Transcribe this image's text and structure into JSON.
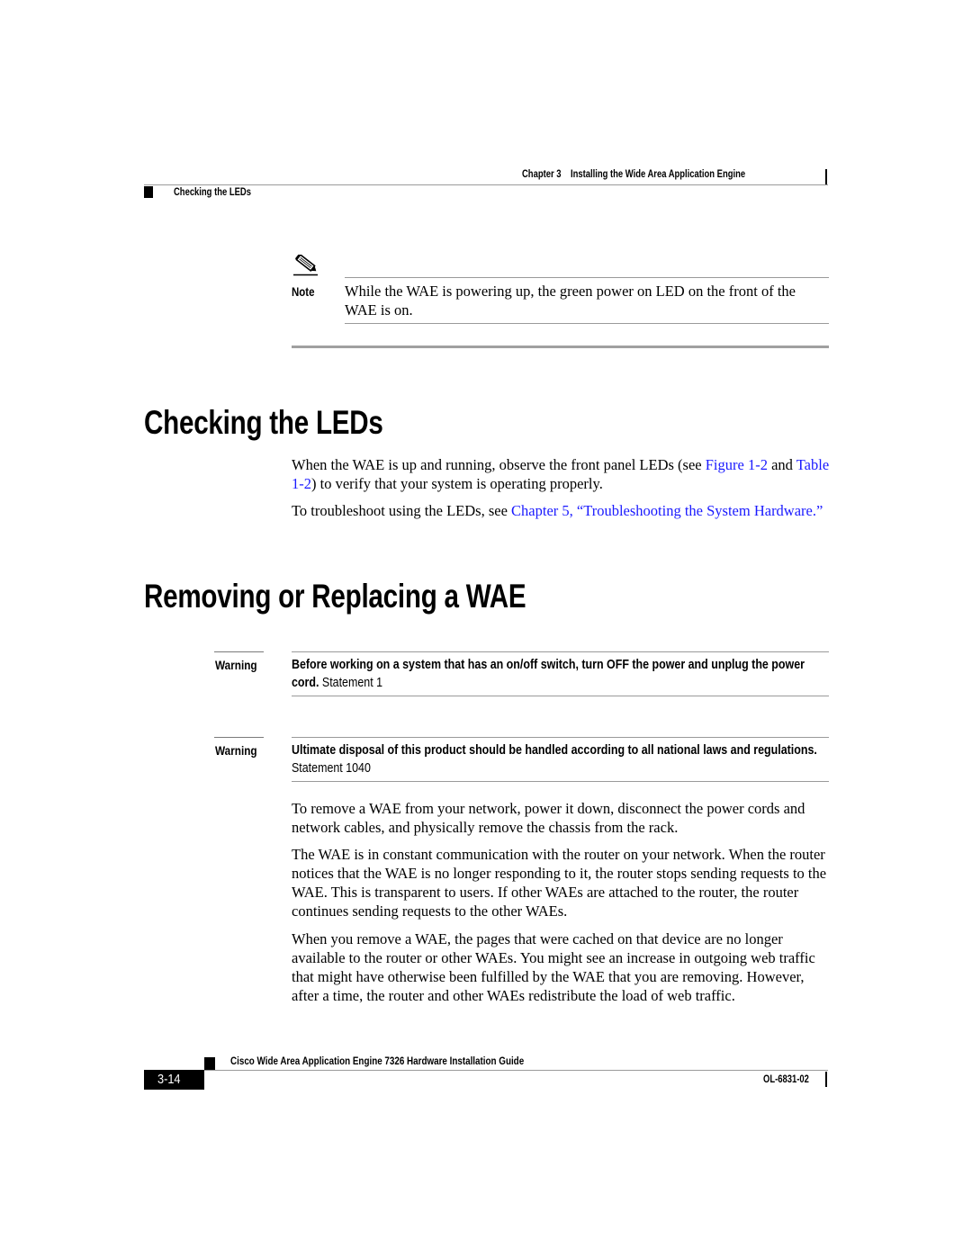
{
  "header": {
    "chapter_label": "Chapter 3",
    "chapter_title": "Installing the Wide Area Application Engine",
    "section": "Checking the LEDs"
  },
  "note": {
    "icon": "pencil-note-icon",
    "label": "Note",
    "text": "While the WAE is powering up, the green power on LED on the front of the WAE is on."
  },
  "sections": [
    {
      "heading": "Checking the LEDs",
      "paragraphs": [
        {
          "t1": "When the WAE is up and running, observe the front panel LEDs (see ",
          "link1": "Figure 1-2",
          "t2": " and ",
          "link2": "Table 1-2",
          "t3": ") to verify that your system is operating properly."
        },
        {
          "t1": "To troubleshoot using the LEDs, see ",
          "link1": "Chapter 5, “Troubleshooting the System Hardware.”"
        }
      ]
    },
    {
      "heading": "Removing or Replacing a WAE",
      "warnings": [
        {
          "label": "Warning",
          "bold": "Before working on a system that has an on/off switch, turn OFF the power and unplug the power cord.",
          "statement": " Statement 1"
        },
        {
          "label": "Warning",
          "bold": "Ultimate disposal of this product should be handled according to all national laws and regulations.",
          "statement": " Statement 1040"
        }
      ],
      "paragraphs": [
        "To remove a WAE from your network, power it down, disconnect the power cords and network cables, and physically remove the chassis from the rack.",
        "The WAE is in constant communication with the router on your network. When the router notices that the WAE is no longer responding to it, the router stops sending requests to the WAE. This is transparent to users. If other WAEs are attached to the router, the router continues sending requests to the other WAEs.",
        "When you remove a WAE, the pages that were cached on that device are no longer available to the router or other WAEs. You might see an increase in outgoing web traffic that might have otherwise been fulfilled by the WAE that you are removing. However, after a time, the router and other WAEs redistribute the load of web traffic."
      ]
    }
  ],
  "footer": {
    "guide_title": "Cisco Wide Area Application Engine 7326 Hardware Installation Guide",
    "page_number": "3-14",
    "doc_number": "OL-6831-02"
  },
  "colors": {
    "link": "#1a1aff",
    "rule": "#9a9a9a"
  }
}
